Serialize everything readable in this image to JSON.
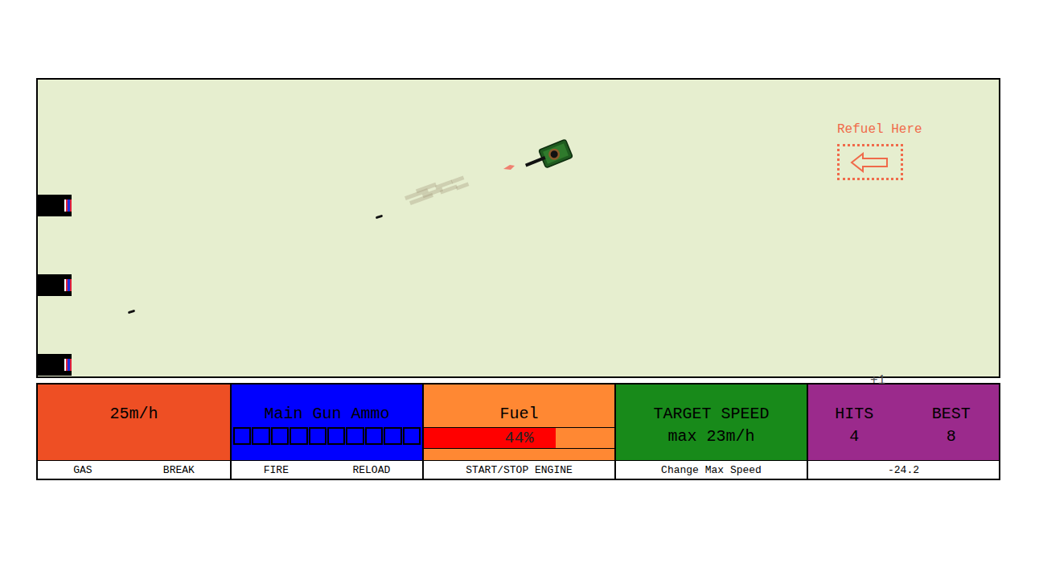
{
  "game": {
    "refuel_label": "Refuel Here",
    "score_popup": "+1"
  },
  "panels": [
    {
      "kind": "speed",
      "title": "25m/h",
      "color": "#ee4f24",
      "controls": [
        "GAS",
        "BREAK"
      ]
    },
    {
      "kind": "ammo",
      "title": "Main Gun Ammo",
      "color": "#0000ff",
      "slots": [
        {
          "loaded": false
        },
        {
          "loaded": false
        },
        {
          "loaded": false
        },
        {
          "loaded": false
        },
        {
          "loaded": false
        },
        {
          "loaded": false
        },
        {
          "loaded": false
        },
        {
          "loaded": false
        },
        {
          "loaded": false
        },
        {
          "loaded": false
        }
      ],
      "controls": [
        "FIRE",
        "RELOAD"
      ]
    },
    {
      "kind": "fuel",
      "title": "Fuel",
      "color": "#ff8833",
      "level": 0.69,
      "reading": "44%",
      "controls": [
        "START/STOP ENGINE"
      ]
    },
    {
      "kind": "target",
      "title": "TARGET SPEED",
      "subtitle": "max 23m/h",
      "color": "#188a1a",
      "controls": [
        "Change Max Speed"
      ]
    },
    {
      "kind": "score",
      "color": "#9b2a8c",
      "stats": [
        {
          "label": "HITS",
          "value": "4"
        },
        {
          "label": "BEST",
          "value": "8"
        }
      ],
      "controls": [
        "-24.2"
      ]
    }
  ]
}
